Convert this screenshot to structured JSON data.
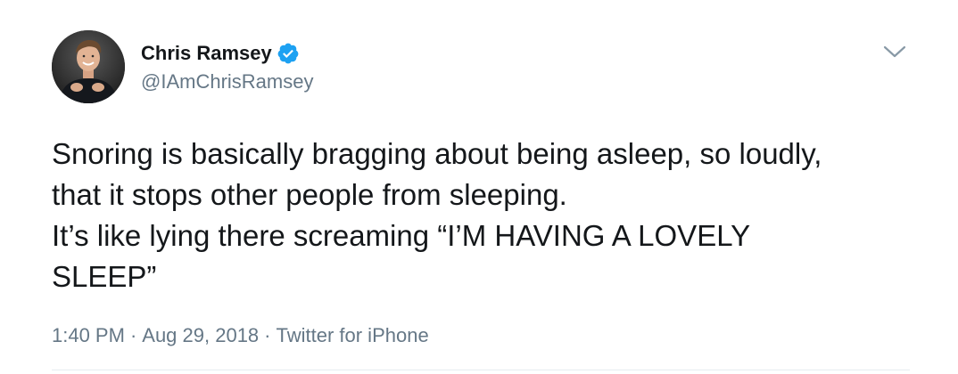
{
  "tweet": {
    "author": {
      "display_name": "Chris Ramsey",
      "handle": "@IAmChrisRamsey",
      "verified": true,
      "avatar_icon": "profile-photo"
    },
    "text_lines": [
      "Snoring is basically bragging about being asleep, so loudly,",
      "that it stops other people from sleeping.",
      "It’s like lying there screaming “I’M HAVING A LOVELY",
      "SLEEP”"
    ],
    "meta": {
      "time": "1:40 PM",
      "date": "Aug 29, 2018",
      "source": "Twitter for iPhone",
      "separator": "·"
    },
    "menu_icon": "chevron-down-icon"
  },
  "colors": {
    "text": "#14171a",
    "secondary": "#657786",
    "verified_blue": "#1da1f2",
    "divider": "#e6ecf0"
  }
}
